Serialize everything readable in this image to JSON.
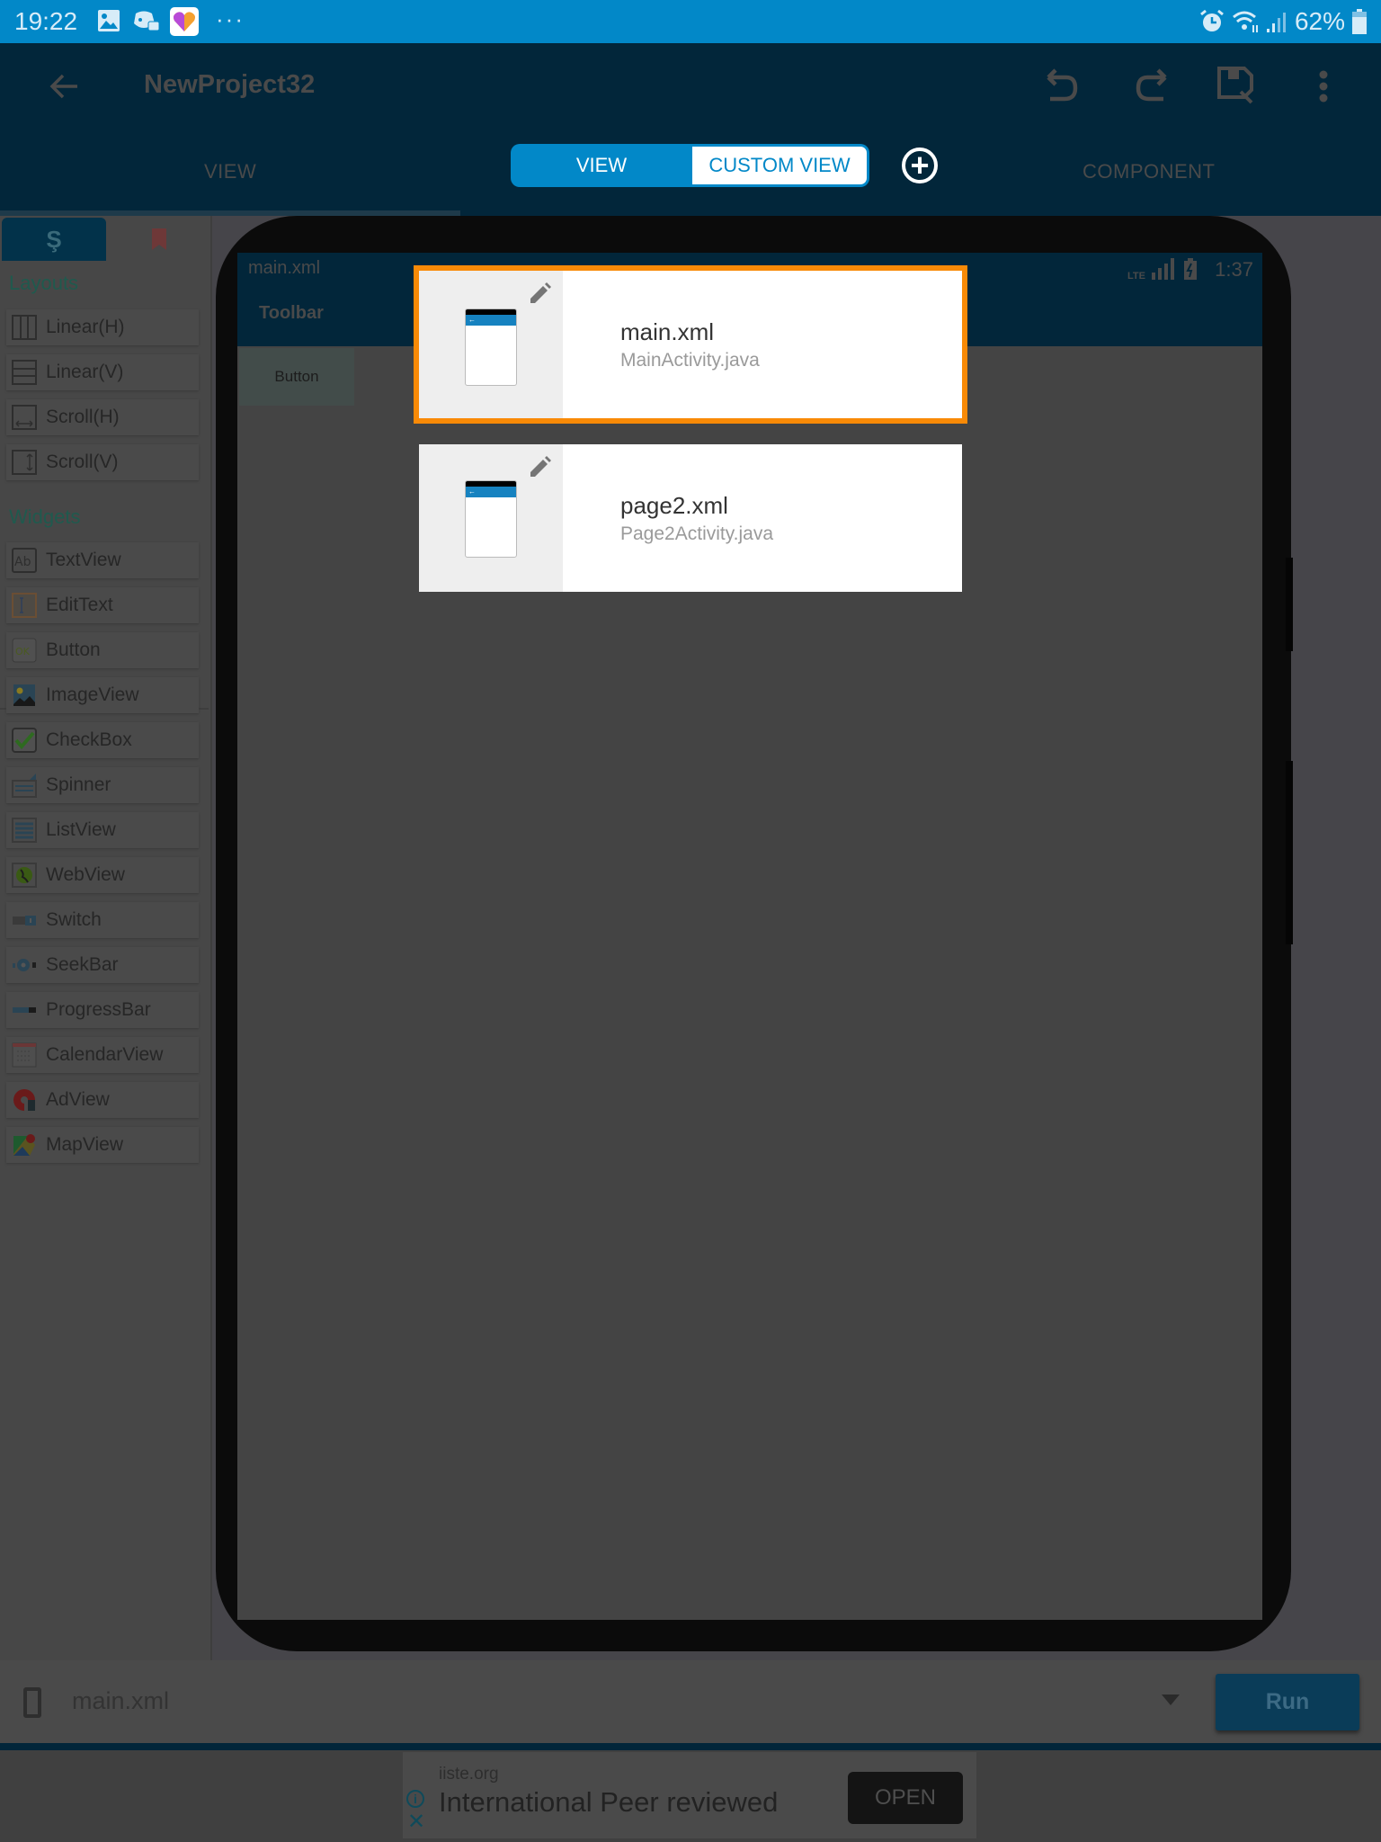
{
  "status_bar": {
    "time": "19:22",
    "left_icons": [
      "gallery-icon",
      "discord-icon",
      "likee-app-icon",
      "more-notifications-icon"
    ],
    "right_icons": [
      "alarm-icon",
      "wifi-icon",
      "cell-signal-icon",
      "battery-icon"
    ],
    "battery_percent": "62%"
  },
  "app_bar": {
    "title": "NewProject32",
    "actions": [
      "undo-icon",
      "redo-icon",
      "save-icon",
      "more-vert-icon"
    ]
  },
  "tabs": [
    {
      "label": "VIEW",
      "active": true
    },
    {
      "label": "COMPONENT",
      "active": false
    }
  ],
  "view_toggle": {
    "options": [
      "VIEW",
      "CUSTOM VIEW"
    ],
    "selected": "VIEW",
    "add_icon": "add-circle-icon"
  },
  "sidebar": {
    "tabs": [
      "palette-tab",
      "bookmark-tab"
    ],
    "sections": [
      {
        "title": "Layouts",
        "items": [
          {
            "label": "Linear(H)",
            "icon": "linear-horizontal-icon"
          },
          {
            "label": "Linear(V)",
            "icon": "linear-vertical-icon"
          },
          {
            "label": "Scroll(H)",
            "icon": "scroll-horizontal-icon"
          },
          {
            "label": "Scroll(V)",
            "icon": "scroll-vertical-icon"
          }
        ]
      },
      {
        "title": "Widgets",
        "items": [
          {
            "label": "TextView",
            "icon": "textview-icon"
          },
          {
            "label": "EditText",
            "icon": "edittext-icon"
          },
          {
            "label": "Button",
            "icon": "button-icon"
          },
          {
            "label": "ImageView",
            "icon": "imageview-icon"
          },
          {
            "label": "CheckBox",
            "icon": "checkbox-icon"
          },
          {
            "label": "Spinner",
            "icon": "spinner-icon"
          },
          {
            "label": "ListView",
            "icon": "listview-icon"
          },
          {
            "label": "WebView",
            "icon": "webview-icon"
          },
          {
            "label": "Switch",
            "icon": "switch-icon"
          },
          {
            "label": "SeekBar",
            "icon": "seekbar-icon"
          },
          {
            "label": "ProgressBar",
            "icon": "progressbar-icon"
          },
          {
            "label": "CalendarView",
            "icon": "calendarview-icon"
          },
          {
            "label": "AdView",
            "icon": "adview-icon"
          },
          {
            "label": "MapView",
            "icon": "mapview-icon"
          }
        ]
      }
    ]
  },
  "device_preview": {
    "screen_title": "main.xml",
    "toolbar_label": "Toolbar",
    "status_time": "1:37",
    "status_network": "LTE",
    "button_label": "Button"
  },
  "view_list": [
    {
      "xml": "main.xml",
      "activity": "MainActivity.java",
      "selected": true
    },
    {
      "xml": "page2.xml",
      "activity": "Page2Activity.java",
      "selected": false
    }
  ],
  "bottom_bar": {
    "current_file": "main.xml",
    "run_label": "Run"
  },
  "ad": {
    "domain": "iiste.org",
    "headline": "International Peer reviewed",
    "cta": "OPEN"
  }
}
